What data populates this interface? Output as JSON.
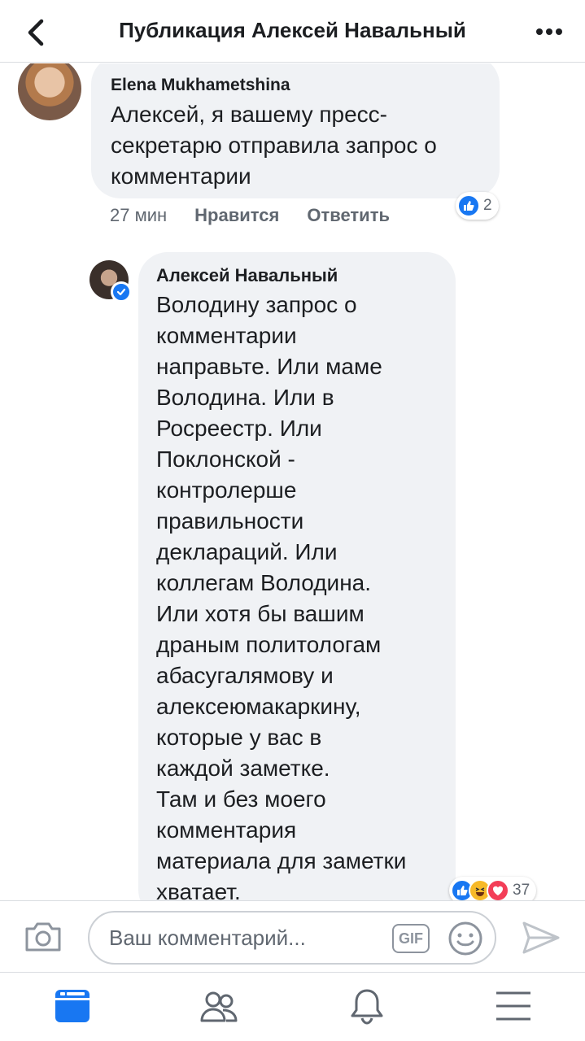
{
  "header": {
    "title": "Публикация Алексей Навальный",
    "back_icon": "chevron-left-icon",
    "more_icon": "more-horizontal-icon"
  },
  "comments": [
    {
      "author": "Elena Mukhametshina",
      "text": "Алексей, я вашему пресс-\nсекретарю отправила запрос о\nкомментарии",
      "time": "27 мин",
      "like_label": "Нравится",
      "reply_label": "Ответить",
      "reactions_count": "2",
      "reactions": [
        "like"
      ]
    },
    {
      "author": "Алексей Навальный",
      "verified": true,
      "text": "Володину запрос о\nкомментарии\nнаправьте. Или маме\nВолодина. Или в\nРосреестр. Или\nПоклонской -\nконтролерше\nправильности\nдеклараций. Или\nколлегам Володина.\nИли хотя бы вашим\nдраным политологам\nабасугалямову и\nалексеюмакаркину,\nкоторые у вас в\nкаждой заметке.\nТам и без моего\nкомментария\nматериала для заметки\nхватает.",
      "reactions_count": "37",
      "reactions": [
        "like",
        "haha",
        "love"
      ]
    }
  ],
  "composer": {
    "placeholder": "Ваш комментарий...",
    "gif_label": "GIF",
    "camera_icon": "camera-icon",
    "emoji_icon": "smiley-icon",
    "send_icon": "send-icon"
  },
  "nav": {
    "items": [
      "feed-icon",
      "friends-icon",
      "bell-icon",
      "menu-icon"
    ],
    "active": "feed-icon"
  },
  "colors": {
    "accent": "#1877f2",
    "bubble": "#f0f2f5",
    "secondary_text": "#606770",
    "haha": "#f7b928",
    "love": "#f33e58"
  }
}
